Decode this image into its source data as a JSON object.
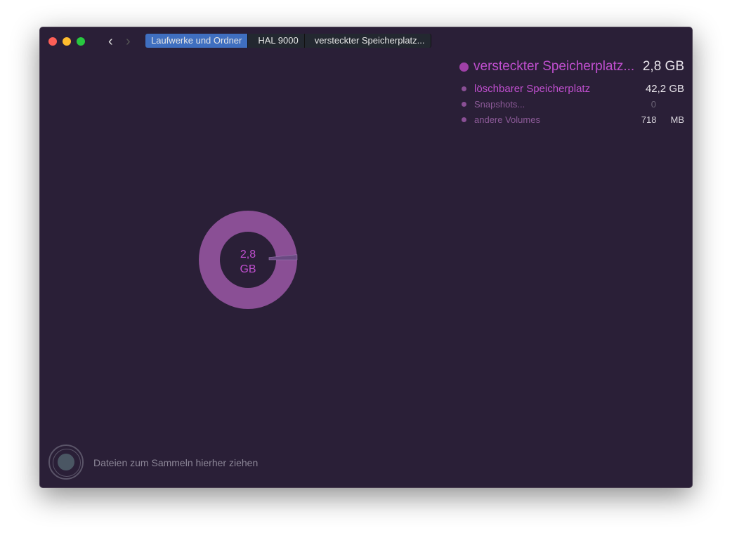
{
  "breadcrumb": [
    "Laufwerke und Ordner",
    "HAL 9000",
    "versteckter Speicherplatz..."
  ],
  "legend": {
    "main": {
      "label": "versteckter Speicherplatz...",
      "value": "2,8 GB"
    },
    "items": [
      {
        "label": "löschbarer Speicherplatz",
        "value": "42,2 GB"
      },
      {
        "label": "Snapshots...",
        "value": "0"
      },
      {
        "label": "andere Volumes",
        "value": "718",
        "unit": "MB"
      }
    ]
  },
  "chart_data": {
    "type": "pie",
    "center_label": [
      "2,8",
      "GB"
    ],
    "slices": [
      {
        "name": "andere Volumes",
        "value_mb": 718
      },
      {
        "name": "main",
        "fraction": 0.99
      }
    ]
  },
  "dropzone": {
    "text": "Dateien zum Sammeln hierher ziehen"
  },
  "colors": {
    "accent": "#c04fcf",
    "slice": "#8a4f95",
    "bg": "#2a1f37"
  }
}
